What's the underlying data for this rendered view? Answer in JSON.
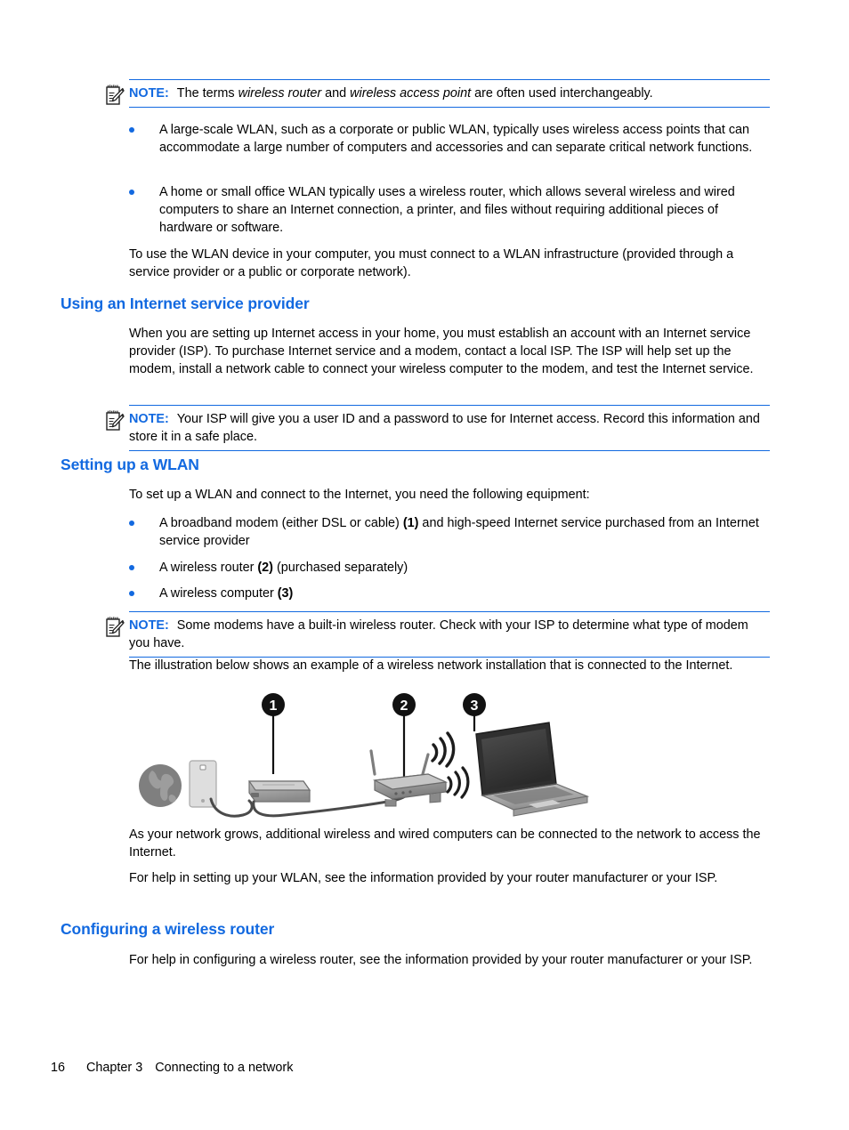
{
  "page": {
    "number": "16",
    "chapter": "Chapter 3",
    "chapter_title": "Connecting to a network"
  },
  "notes": {
    "label": "NOTE:",
    "terms_note": "The terms wireless router and wireless access point are often used interchangeably.",
    "terms_note_parts": {
      "pre": "The terms ",
      "em1": "wireless router",
      "mid": " and ",
      "em2": "wireless access point",
      "post": " are often used interchangeably."
    },
    "isp_note": "Your ISP will give you a user ID and a password to use for Internet access. Record this information and store it in a safe place.",
    "modem_note": "Some modems have a built-in wireless router. Check with your ISP to determine what type of modem you have."
  },
  "intro_bullets": [
    "A large-scale WLAN, such as a corporate or public WLAN, typically uses wireless access points that can accommodate a large number of computers and accessories and can separate critical network functions.",
    "A home or small office WLAN typically uses a wireless router, which allows several wireless and wired computers to share an Internet connection, a printer, and files without requiring additional pieces of hardware or software."
  ],
  "intro_paragraph": "To use the WLAN device in your computer, you must connect to a WLAN infrastructure (provided through a service provider or a public or corporate network).",
  "sections": [
    {
      "id": "isp",
      "heading": "Using an Internet service provider",
      "paragraph": "When you are setting up Internet access in your home, you must establish an account with an Internet service provider (ISP). To purchase Internet service and a modem, contact a local ISP. The ISP will help set up the modem, install a network cable to connect your wireless computer to the modem, and test the Internet service."
    },
    {
      "id": "setup-wlan",
      "heading": "Setting up a WLAN",
      "intro": "To set up a WLAN and connect to the Internet, you need the following equipment:",
      "equipment": [
        {
          "pre": "A broadband modem (either DSL or cable) ",
          "callout": "(1)",
          "post": " and high-speed Internet service purchased from an Internet service provider"
        },
        {
          "pre": "A wireless router ",
          "callout": "(2)",
          "post": " (purchased separately)"
        },
        {
          "pre": "A wireless computer ",
          "callout": "(3)",
          "post": ""
        }
      ],
      "illustration_intro": "The illustration below shows an example of a wireless network installation that is connected to the Internet.",
      "after_illustration_1": "As your network grows, additional wireless and wired computers can be connected to the network to access the Internet.",
      "after_illustration_2": "For help in setting up your WLAN, see the information provided by your router manufacturer or your ISP."
    },
    {
      "id": "config-router",
      "heading": "Configuring a wireless router",
      "paragraph": "For help in configuring a wireless router, see the information provided by your router manufacturer or your ISP."
    }
  ],
  "illustration": {
    "callouts": [
      "1",
      "2",
      "3"
    ],
    "components": [
      "globe-icon",
      "wall-jack",
      "broadband-modem",
      "wireless-router",
      "laptop-computer",
      "wifi-waves"
    ]
  },
  "colors": {
    "heading_blue": "#1269e0",
    "note_rule_blue": "#1269e0",
    "bullet_blue": "#1269e0",
    "text_black": "#000000",
    "page_background": "#ffffff"
  }
}
